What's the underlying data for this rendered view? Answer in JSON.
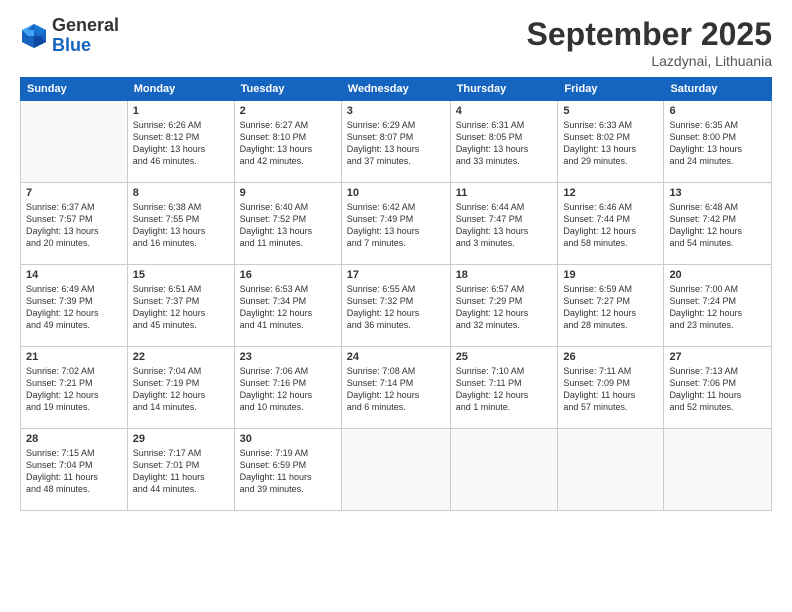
{
  "header": {
    "logo": {
      "line1": "General",
      "line2": "Blue"
    },
    "title": "September 2025",
    "location": "Lazdynai, Lithuania"
  },
  "weekdays": [
    "Sunday",
    "Monday",
    "Tuesday",
    "Wednesday",
    "Thursday",
    "Friday",
    "Saturday"
  ],
  "weeks": [
    [
      {
        "day": "",
        "info": ""
      },
      {
        "day": "1",
        "info": "Sunrise: 6:26 AM\nSunset: 8:12 PM\nDaylight: 13 hours\nand 46 minutes."
      },
      {
        "day": "2",
        "info": "Sunrise: 6:27 AM\nSunset: 8:10 PM\nDaylight: 13 hours\nand 42 minutes."
      },
      {
        "day": "3",
        "info": "Sunrise: 6:29 AM\nSunset: 8:07 PM\nDaylight: 13 hours\nand 37 minutes."
      },
      {
        "day": "4",
        "info": "Sunrise: 6:31 AM\nSunset: 8:05 PM\nDaylight: 13 hours\nand 33 minutes."
      },
      {
        "day": "5",
        "info": "Sunrise: 6:33 AM\nSunset: 8:02 PM\nDaylight: 13 hours\nand 29 minutes."
      },
      {
        "day": "6",
        "info": "Sunrise: 6:35 AM\nSunset: 8:00 PM\nDaylight: 13 hours\nand 24 minutes."
      }
    ],
    [
      {
        "day": "7",
        "info": "Sunrise: 6:37 AM\nSunset: 7:57 PM\nDaylight: 13 hours\nand 20 minutes."
      },
      {
        "day": "8",
        "info": "Sunrise: 6:38 AM\nSunset: 7:55 PM\nDaylight: 13 hours\nand 16 minutes."
      },
      {
        "day": "9",
        "info": "Sunrise: 6:40 AM\nSunset: 7:52 PM\nDaylight: 13 hours\nand 11 minutes."
      },
      {
        "day": "10",
        "info": "Sunrise: 6:42 AM\nSunset: 7:49 PM\nDaylight: 13 hours\nand 7 minutes."
      },
      {
        "day": "11",
        "info": "Sunrise: 6:44 AM\nSunset: 7:47 PM\nDaylight: 13 hours\nand 3 minutes."
      },
      {
        "day": "12",
        "info": "Sunrise: 6:46 AM\nSunset: 7:44 PM\nDaylight: 12 hours\nand 58 minutes."
      },
      {
        "day": "13",
        "info": "Sunrise: 6:48 AM\nSunset: 7:42 PM\nDaylight: 12 hours\nand 54 minutes."
      }
    ],
    [
      {
        "day": "14",
        "info": "Sunrise: 6:49 AM\nSunset: 7:39 PM\nDaylight: 12 hours\nand 49 minutes."
      },
      {
        "day": "15",
        "info": "Sunrise: 6:51 AM\nSunset: 7:37 PM\nDaylight: 12 hours\nand 45 minutes."
      },
      {
        "day": "16",
        "info": "Sunrise: 6:53 AM\nSunset: 7:34 PM\nDaylight: 12 hours\nand 41 minutes."
      },
      {
        "day": "17",
        "info": "Sunrise: 6:55 AM\nSunset: 7:32 PM\nDaylight: 12 hours\nand 36 minutes."
      },
      {
        "day": "18",
        "info": "Sunrise: 6:57 AM\nSunset: 7:29 PM\nDaylight: 12 hours\nand 32 minutes."
      },
      {
        "day": "19",
        "info": "Sunrise: 6:59 AM\nSunset: 7:27 PM\nDaylight: 12 hours\nand 28 minutes."
      },
      {
        "day": "20",
        "info": "Sunrise: 7:00 AM\nSunset: 7:24 PM\nDaylight: 12 hours\nand 23 minutes."
      }
    ],
    [
      {
        "day": "21",
        "info": "Sunrise: 7:02 AM\nSunset: 7:21 PM\nDaylight: 12 hours\nand 19 minutes."
      },
      {
        "day": "22",
        "info": "Sunrise: 7:04 AM\nSunset: 7:19 PM\nDaylight: 12 hours\nand 14 minutes."
      },
      {
        "day": "23",
        "info": "Sunrise: 7:06 AM\nSunset: 7:16 PM\nDaylight: 12 hours\nand 10 minutes."
      },
      {
        "day": "24",
        "info": "Sunrise: 7:08 AM\nSunset: 7:14 PM\nDaylight: 12 hours\nand 6 minutes."
      },
      {
        "day": "25",
        "info": "Sunrise: 7:10 AM\nSunset: 7:11 PM\nDaylight: 12 hours\nand 1 minute."
      },
      {
        "day": "26",
        "info": "Sunrise: 7:11 AM\nSunset: 7:09 PM\nDaylight: 11 hours\nand 57 minutes."
      },
      {
        "day": "27",
        "info": "Sunrise: 7:13 AM\nSunset: 7:06 PM\nDaylight: 11 hours\nand 52 minutes."
      }
    ],
    [
      {
        "day": "28",
        "info": "Sunrise: 7:15 AM\nSunset: 7:04 PM\nDaylight: 11 hours\nand 48 minutes."
      },
      {
        "day": "29",
        "info": "Sunrise: 7:17 AM\nSunset: 7:01 PM\nDaylight: 11 hours\nand 44 minutes."
      },
      {
        "day": "30",
        "info": "Sunrise: 7:19 AM\nSunset: 6:59 PM\nDaylight: 11 hours\nand 39 minutes."
      },
      {
        "day": "",
        "info": ""
      },
      {
        "day": "",
        "info": ""
      },
      {
        "day": "",
        "info": ""
      },
      {
        "day": "",
        "info": ""
      }
    ]
  ]
}
